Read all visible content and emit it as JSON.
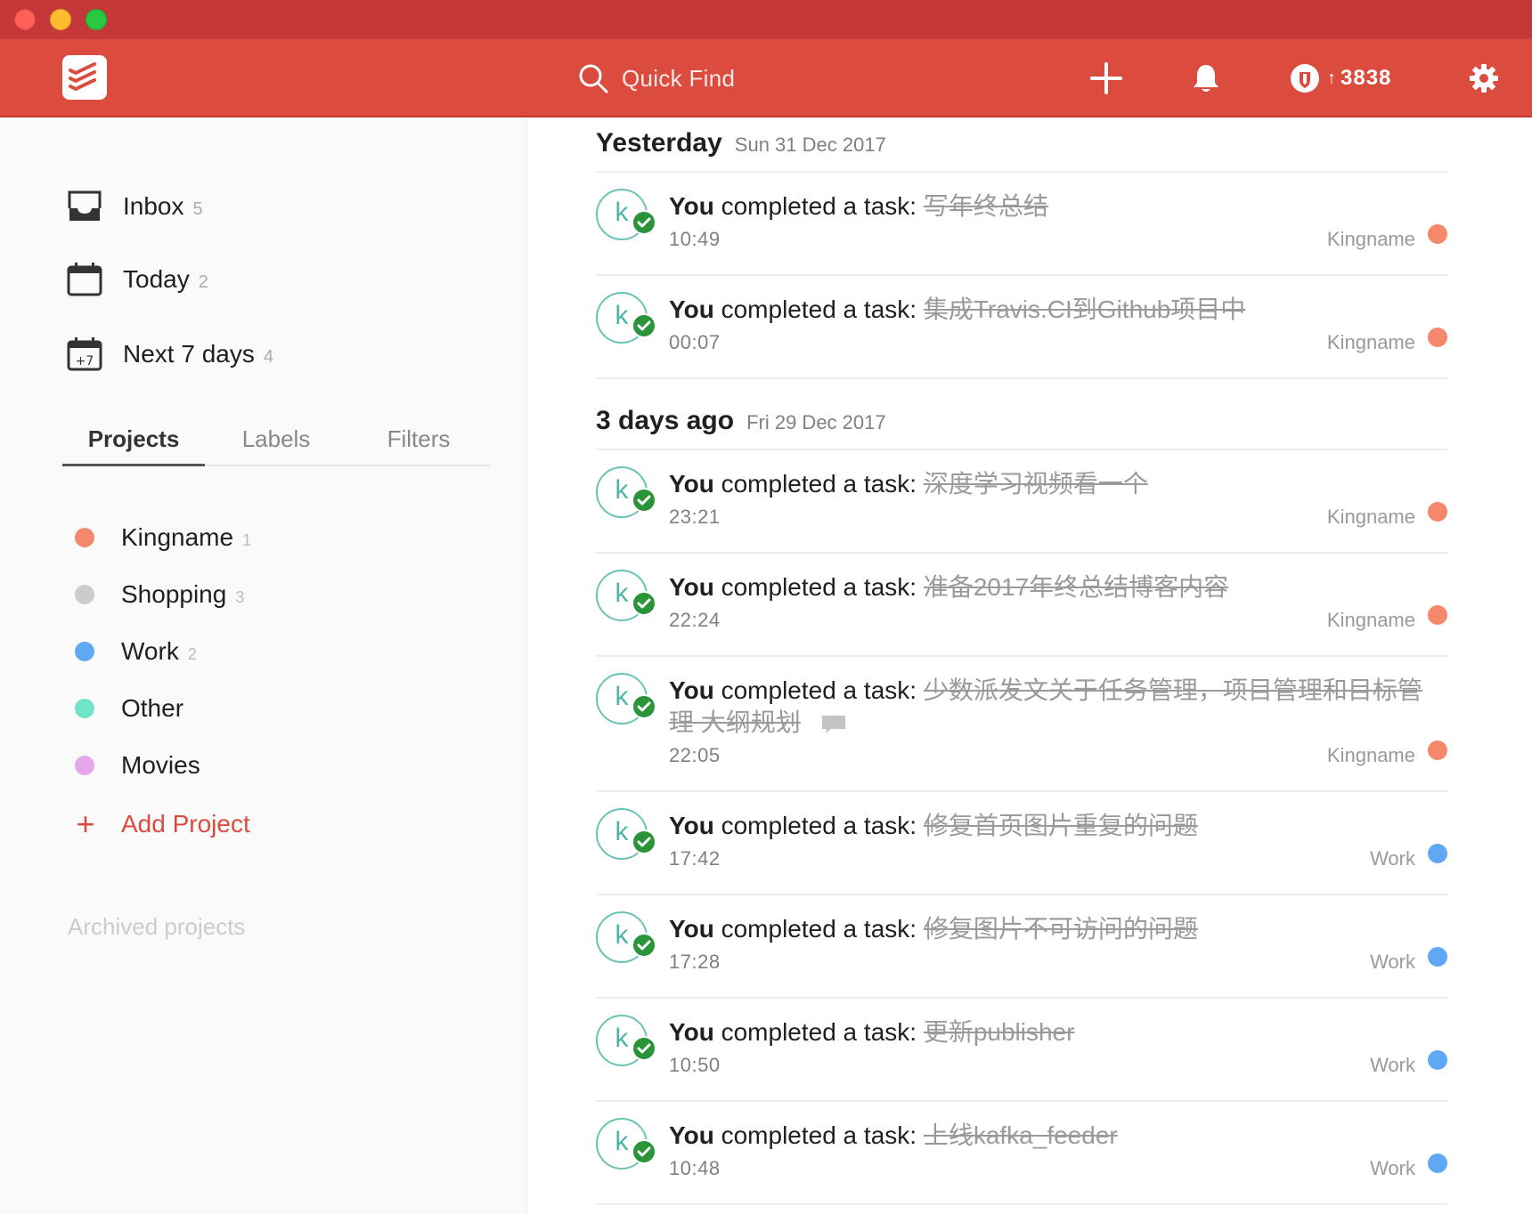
{
  "header": {
    "search_placeholder": "Quick Find",
    "karma_value": "3838"
  },
  "sidebar": {
    "filters": [
      {
        "label": "Inbox",
        "count": "5",
        "icon": "inbox-icon"
      },
      {
        "label": "Today",
        "count": "2",
        "icon": "calendar-icon"
      },
      {
        "label": "Next 7 days",
        "count": "4",
        "icon": "calendar-plus7-icon",
        "icon_text": "+7"
      }
    ],
    "tabs": [
      "Projects",
      "Labels",
      "Filters"
    ],
    "active_tab": "Projects",
    "projects": [
      {
        "name": "Kingname",
        "count": "1",
        "color": "#f5886a"
      },
      {
        "name": "Shopping",
        "count": "3",
        "color": "#cccccc"
      },
      {
        "name": "Work",
        "count": "2",
        "color": "#5fa8f5"
      },
      {
        "name": "Other",
        "count": "",
        "color": "#6fe4c7"
      },
      {
        "name": "Movies",
        "count": "",
        "color": "#e6a7ea"
      }
    ],
    "add_project_label": "Add Project",
    "archived_label": "Archived projects"
  },
  "activity": {
    "completed_prefix_who": "You",
    "completed_prefix_action": "completed a task:",
    "avatar_letter": "k",
    "groups": [
      {
        "title": "Yesterday",
        "date": "Sun 31 Dec 2017",
        "events": [
          {
            "task": "写年终总结",
            "time": "10:49",
            "project": "Kingname",
            "color": "#f5886a"
          },
          {
            "task": "集成Travis.CI到Github项目中",
            "time": "00:07",
            "project": "Kingname",
            "color": "#f5886a"
          }
        ]
      },
      {
        "title": "3 days ago",
        "date": "Fri 29 Dec 2017",
        "events": [
          {
            "task": "深度学习视频看一个",
            "time": "23:21",
            "project": "Kingname",
            "color": "#f5886a"
          },
          {
            "task": "准备2017年终总结博客内容",
            "time": "22:24",
            "project": "Kingname",
            "color": "#f5886a"
          },
          {
            "task": "少数派发文关于任务管理，项目管理和目标管理 大纲规划",
            "time": "22:05",
            "project": "Kingname",
            "color": "#f5886a",
            "has_comment": true
          },
          {
            "task": "修复首页图片重复的问题",
            "time": "17:42",
            "project": "Work",
            "color": "#5fa8f5"
          },
          {
            "task": "修复图片不可访问的问题",
            "time": "17:28",
            "project": "Work",
            "color": "#5fa8f5"
          },
          {
            "task": "更新publisher",
            "time": "10:50",
            "project": "Work",
            "color": "#5fa8f5"
          },
          {
            "task": "上线kafka_feeder",
            "time": "10:48",
            "project": "Work",
            "color": "#5fa8f5"
          }
        ]
      }
    ]
  },
  "colors": {
    "brand_red": "#db4c3f",
    "titlebar_red": "#c4383a",
    "avatar_teal": "#4eb5a4",
    "check_green": "#299438"
  }
}
